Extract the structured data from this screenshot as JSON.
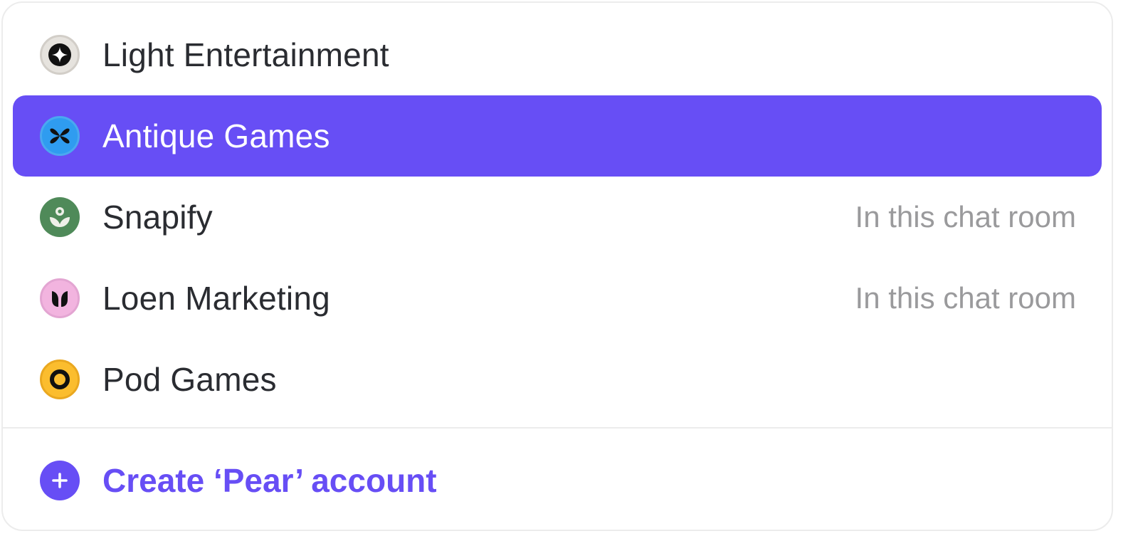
{
  "accounts": [
    {
      "name": "Light Entertainment",
      "status": "",
      "selected": false,
      "icon": "sparkle-icon",
      "icon_bg": "#e6e3de",
      "icon_border": "#d2cec8"
    },
    {
      "name": "Antique Games",
      "status": "",
      "selected": true,
      "icon": "butterfly-icon",
      "icon_bg": "#2f9cf0",
      "icon_border": "#4aa8f0"
    },
    {
      "name": "Snapify",
      "status": "In this chat room",
      "selected": false,
      "icon": "sprout-icon",
      "icon_bg": "#4f8a59",
      "icon_border": "#4f8a59"
    },
    {
      "name": "Loen Marketing",
      "status": "In this chat room",
      "selected": false,
      "icon": "tulip-icon",
      "icon_bg": "#f2b4df",
      "icon_border": "#e3a5d2"
    },
    {
      "name": "Pod Games",
      "status": "",
      "selected": false,
      "icon": "ring-icon",
      "icon_bg": "#fbbd2e",
      "icon_border": "#eaa820"
    }
  ],
  "create": {
    "label": "Create ‘Pear’ account",
    "icon": "plus-icon"
  },
  "colors": {
    "accent": "#674ef5",
    "text": "#2a2c31",
    "muted": "#9a9a9c",
    "divider": "#ececec"
  }
}
